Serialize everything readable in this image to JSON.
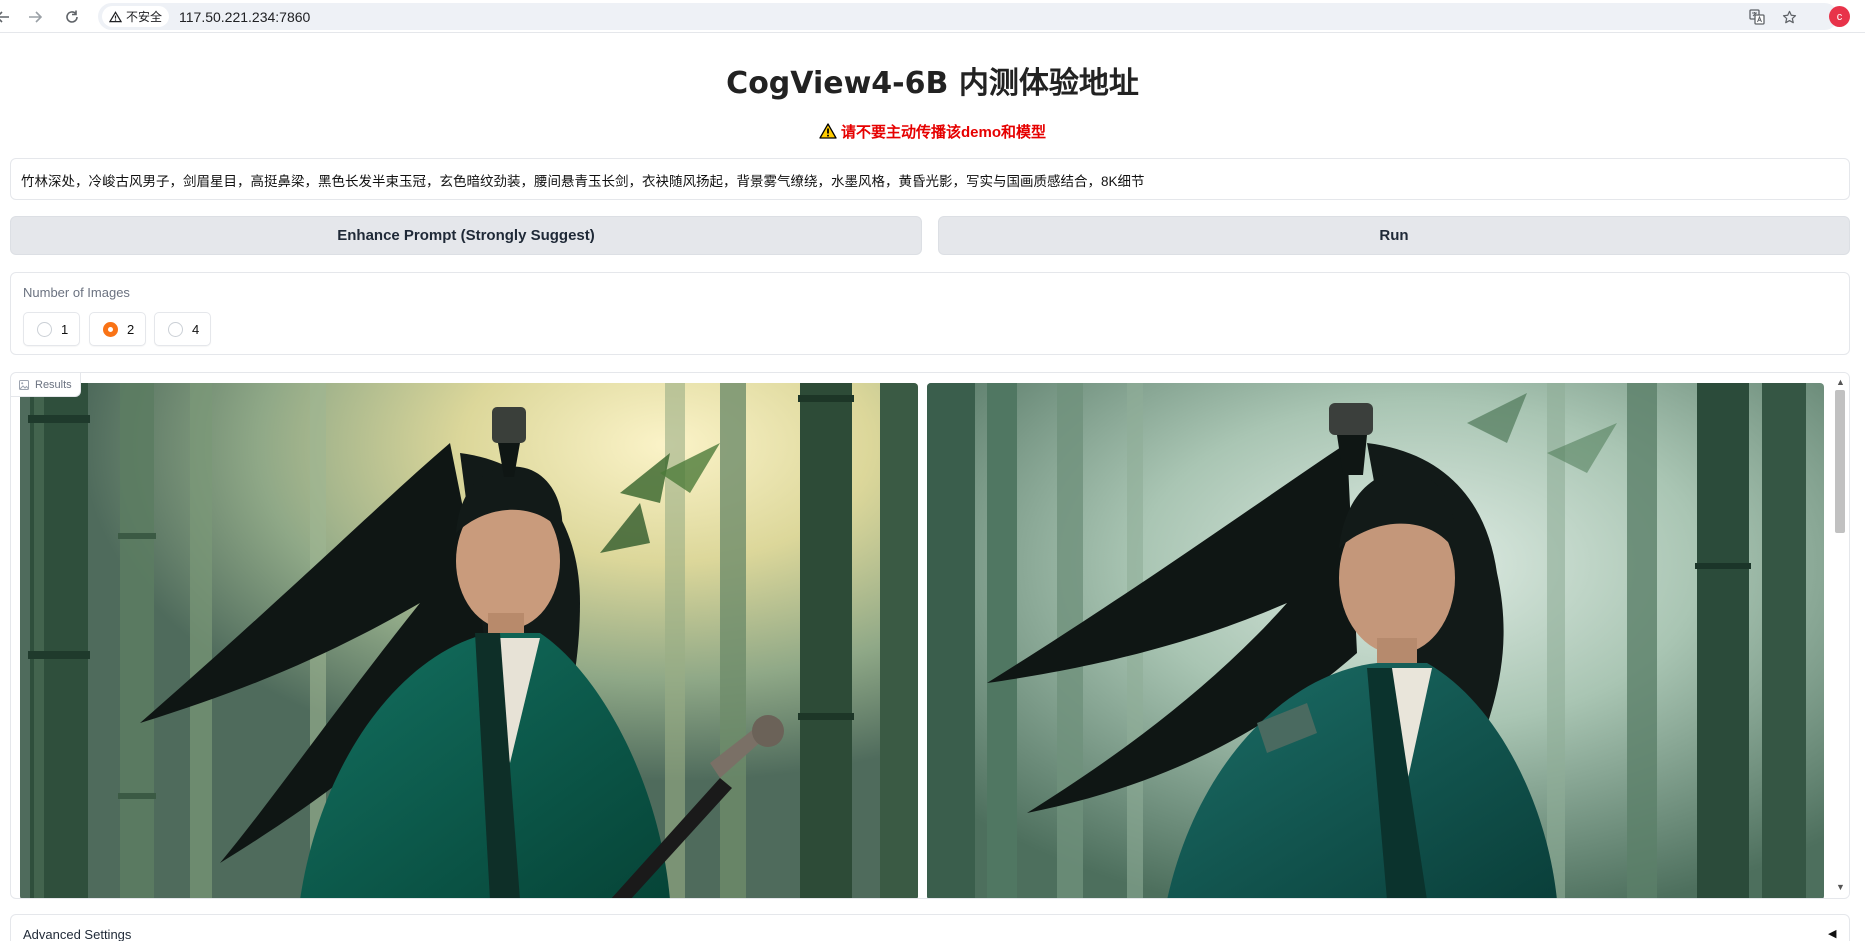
{
  "browser": {
    "security_label": "不安全",
    "url": "117.50.221.234:7860",
    "profile_initial": "c"
  },
  "app": {
    "title": "CogView4-6B 内测体验地址",
    "warning": "请不要主动传播该demo和模型",
    "warning_color": "#e60000",
    "prompt": "竹林深处，冷峻古风男子，剑眉星目，高挺鼻梁，黑色长发半束玉冠，玄色暗纹劲装，腰间悬青玉长剑，衣袂随风扬起，背景雾气缭绕，水墨风格，黄昏光影，写实与国画质感结合，8K细节",
    "enhance_button": "Enhance Prompt (Strongly Suggest)",
    "run_button": "Run",
    "num_images": {
      "label": "Number of Images",
      "options": [
        "1",
        "2",
        "4"
      ],
      "selected": "2"
    },
    "results_label": "Results",
    "advanced_label": "Advanced Settings",
    "accent_color": "#f97316"
  },
  "icons": {
    "back": "arrow-left-icon",
    "forward": "arrow-right-icon",
    "reload": "reload-icon",
    "warning": "warning-triangle-icon",
    "translate": "translate-icon",
    "bookmark": "star-icon",
    "results": "image-icon",
    "collapse": "caret-left-icon"
  }
}
